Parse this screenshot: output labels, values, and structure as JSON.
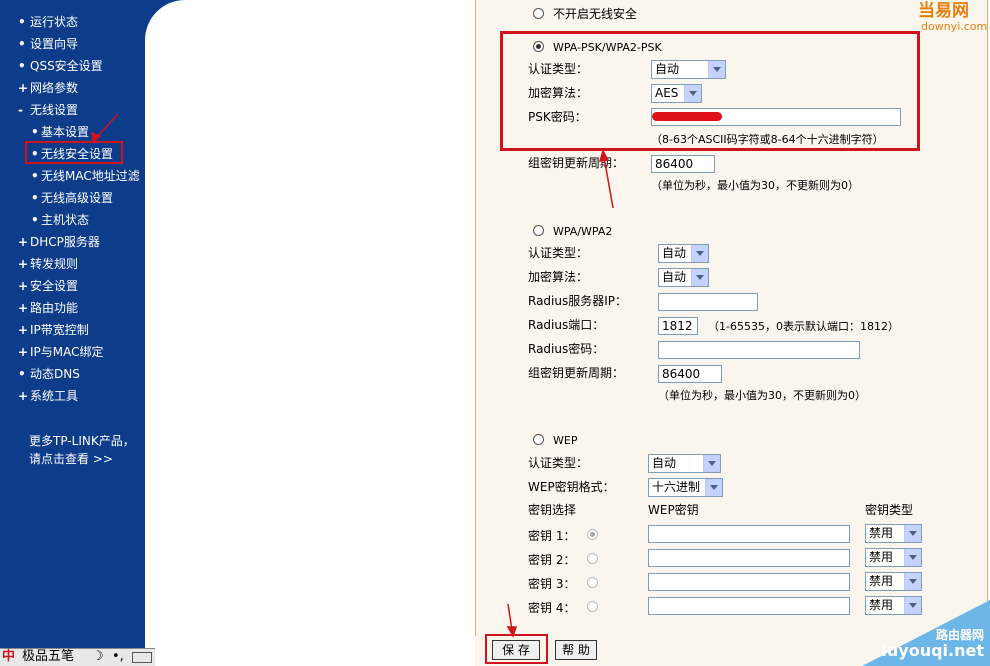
{
  "sidebar": {
    "items": [
      {
        "mark": "•",
        "label": "运行状态"
      },
      {
        "mark": "•",
        "label": "设置向导"
      },
      {
        "mark": "•",
        "label": "QSS安全设置"
      },
      {
        "mark": "+",
        "label": "网络参数"
      },
      {
        "mark": "-",
        "label": "无线设置"
      },
      {
        "mark": "•",
        "label": "基本设置"
      },
      {
        "mark": "•",
        "label": "无线安全设置"
      },
      {
        "mark": "•",
        "label": "无线MAC地址过滤"
      },
      {
        "mark": "•",
        "label": "无线高级设置"
      },
      {
        "mark": "•",
        "label": "主机状态"
      },
      {
        "mark": "+",
        "label": "DHCP服务器"
      },
      {
        "mark": "+",
        "label": "转发规则"
      },
      {
        "mark": "+",
        "label": "安全设置"
      },
      {
        "mark": "+",
        "label": "路由功能"
      },
      {
        "mark": "+",
        "label": "IP带宽控制"
      },
      {
        "mark": "+",
        "label": "IP与MAC绑定"
      },
      {
        "mark": "•",
        "label": "动态DNS"
      },
      {
        "mark": "+",
        "label": "系统工具"
      }
    ],
    "more_line1": "更多TP-LINK产品，",
    "more_line2": "请点击查看 >>"
  },
  "ime": {
    "label": "极品五笔",
    "moon": "☽",
    "punct": "•,"
  },
  "no_security": {
    "label": "不开启无线安全"
  },
  "wpa_psk": {
    "title": "WPA-PSK/WPA2-PSK",
    "auth_label": "认证类型：",
    "auth_value": "自动",
    "enc_label": "加密算法：",
    "enc_value": "AES",
    "psk_label": "PSK密码：",
    "psk_hint": "（8-63个ASCII码字符或8-64个十六进制字符）",
    "group_label": "组密钥更新周期：",
    "group_value": "86400",
    "group_hint": "（单位为秒，最小值为30，不更新则为0）"
  },
  "wpa": {
    "title": "WPA/WPA2",
    "auth_label": "认证类型：",
    "auth_value": "自动",
    "enc_label": "加密算法：",
    "enc_value": "自动",
    "radius_ip_label": "Radius服务器IP：",
    "radius_ip_value": "",
    "radius_port_label": "Radius端口：",
    "radius_port_value": "1812",
    "radius_port_hint": "（1-65535，0表示默认端口：1812）",
    "radius_pwd_label": "Radius密码：",
    "radius_pwd_value": "",
    "group_label": "组密钥更新周期：",
    "group_value": "86400",
    "group_hint": "（单位为秒，最小值为30，不更新则为0）"
  },
  "wep": {
    "title": "WEP",
    "auth_label": "认证类型：",
    "auth_value": "自动",
    "format_label": "WEP密钥格式：",
    "format_value": "十六进制",
    "col_select": "密钥选择",
    "col_key": "WEP密钥",
    "col_type": "密钥类型",
    "keys": [
      {
        "label": "密钥 1：",
        "value": "",
        "type": "禁用"
      },
      {
        "label": "密钥 2：",
        "value": "",
        "type": "禁用"
      },
      {
        "label": "密钥 3：",
        "value": "",
        "type": "禁用"
      },
      {
        "label": "密钥 4：",
        "value": "",
        "type": "禁用"
      }
    ]
  },
  "buttons": {
    "save": "保 存",
    "help": "帮 助"
  },
  "watermarks": {
    "top_cn": "当易网",
    "top_en": "downyi.com",
    "bottom_cn": "路由器网",
    "bottom_en": "luyouqi.net"
  },
  "colors": {
    "sidebar": "#0d3c8a",
    "panel": "#fbf6ed",
    "highlight": "#d0141e"
  }
}
